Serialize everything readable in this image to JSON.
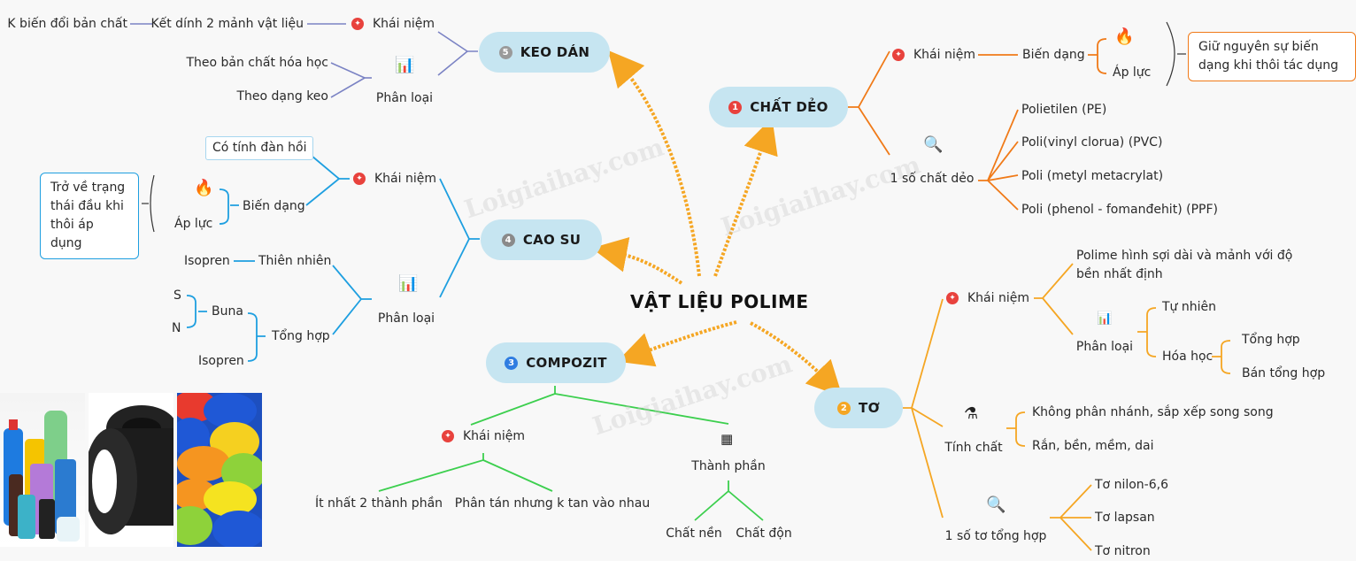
{
  "center": {
    "title": "VẬT LIỆU POLIME"
  },
  "watermark": "Loigiaihay.com",
  "colors": {
    "keo_dan": "#7b83c4",
    "chat_deo": "#f07a18",
    "to": "#f5a623",
    "compozit": "#3ccf4e",
    "cao_su": "#1e9fe0",
    "arrow": "#f5a623",
    "node_fill": "#c6e5f1"
  },
  "branches": {
    "chat_deo": {
      "number": "1",
      "label": "CHẤT DẺO",
      "khai_niem": {
        "label": "Khái niệm",
        "bien_dang": "Biến dạng",
        "children": [
          "Áp lực"
        ],
        "icon": "fire-icon",
        "note": "Giữ nguyên sự biến dạng khi thôi tác dụng"
      },
      "examples": {
        "label": "1 số chất dẻo",
        "icon": "magnifier-chart-icon",
        "items": [
          "Polietilen (PE)",
          "Poli(vinyl clorua) (PVC)",
          "Poli (metyl metacrylat)",
          "Poli (phenol - fomanđehit) (PPF)"
        ]
      }
    },
    "to": {
      "number": "2",
      "label": "TƠ",
      "khai_niem": {
        "label": "Khái niệm",
        "definition": "Polime hình sợi dài và mảnh với độ bền nhất định",
        "phan_loai": {
          "label": "Phân loại",
          "tu_nhien": "Tự nhiên",
          "hoa_hoc": "Hóa học",
          "hoa_hoc_items": [
            "Tổng hợp",
            "Bán tổng hợp"
          ]
        }
      },
      "tinh_chat": {
        "label": "Tính chất",
        "icon": "lab-flask-icon",
        "items": [
          "Không phân nhánh, sắp xếp song song",
          "Rắn, bền, mềm, dai"
        ]
      },
      "examples": {
        "label": "1 số tơ tổng hợp",
        "icon": "magnifier-chart-icon",
        "items": [
          "Tơ nilon-6,6",
          "Tơ lapsan",
          "Tơ nitron"
        ]
      }
    },
    "compozit": {
      "number": "3",
      "label": "COMPOZIT",
      "khai_niem": {
        "label": "Khái niệm",
        "items": [
          "Ít nhất 2 thành phần",
          "Phân tán nhưng k tan vào nhau"
        ]
      },
      "thanh_phan": {
        "label": "Thành phần",
        "icon": "components-icon",
        "items": [
          "Chất nền",
          "Chất độn"
        ]
      }
    },
    "cao_su": {
      "number": "4",
      "label": "CAO SU",
      "khai_niem": {
        "label": "Khái niệm",
        "property": "Có tính đàn hồi",
        "bien_dang": "Biến dạng",
        "children": [
          "Áp lực"
        ],
        "note": "Trở về trạng thái đầu khi thôi áp dụng"
      },
      "phan_loai": {
        "label": "Phân loại",
        "thien_nhien": "Thiên nhiên",
        "thien_nhien_item": "Isopren",
        "tong_hop": "Tổng hợp",
        "buna": "Buna",
        "buna_items": [
          "S",
          "N"
        ],
        "isopren": "Isopren"
      }
    },
    "keo_dan": {
      "number": "5",
      "label": "KEO DÁN",
      "khai_niem": {
        "label": "Khái niệm",
        "item": "Kết dính 2 mảnh vật liệu",
        "sub": "K biến đổi bản chất"
      },
      "phan_loai": {
        "label": "Phân loại",
        "items": [
          "Theo bản chất hóa học",
          "Theo dạng keo"
        ]
      }
    }
  },
  "photos": [
    {
      "name": "plastic-bottles-photo"
    },
    {
      "name": "tires-photo"
    },
    {
      "name": "colorful-yarn-photo"
    }
  ]
}
